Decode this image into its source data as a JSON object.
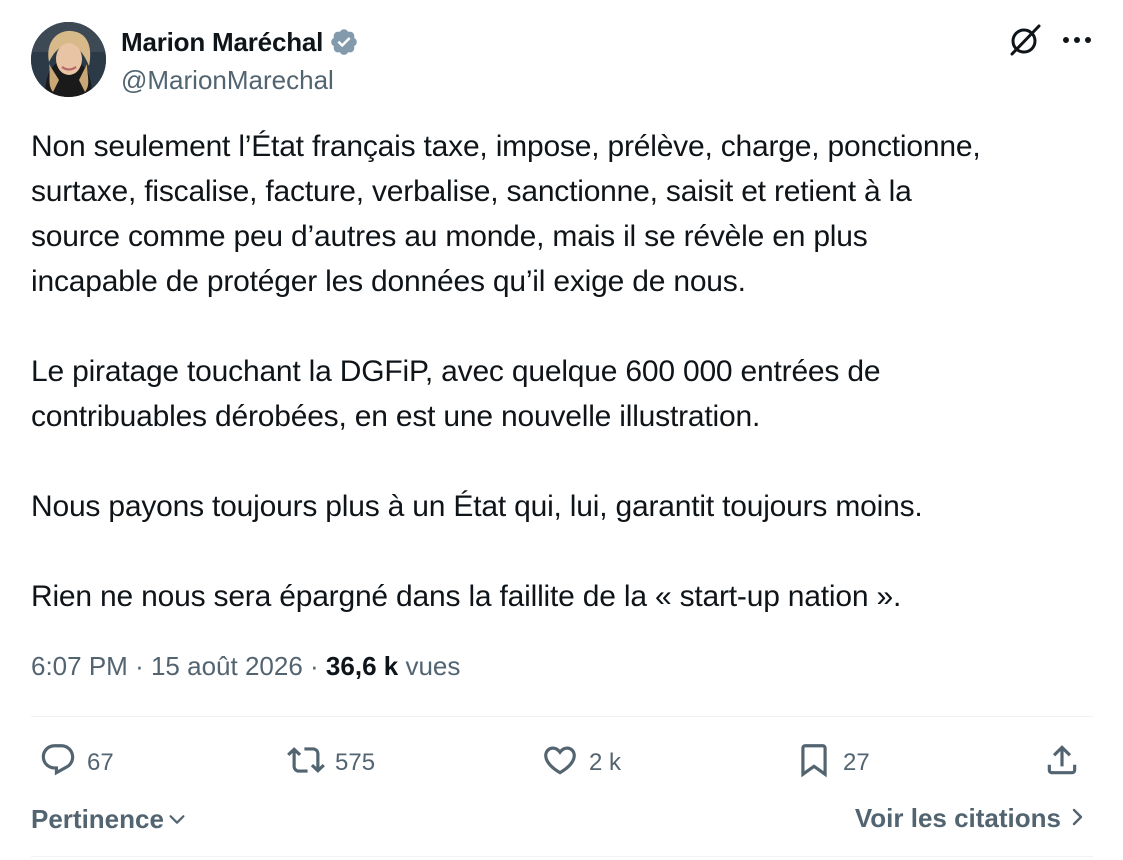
{
  "author": {
    "name": "Marion Maréchal",
    "handle": "@MarionMarechal",
    "verified": true
  },
  "tweet": {
    "paragraphs": [
      [
        "Non seulement l’État français taxe, impose, prélève, charge, ponctionne,",
        "surtaxe, fiscalise, facture, verbalise, sanctionne, saisit et retient à la",
        "source comme peu d’autres au monde, mais il se révèle en plus",
        "incapable de protéger les données qu’il exige de nous."
      ],
      [
        "Le piratage touchant la DGFiP, avec quelque 600 000 entrées de",
        "contribuables dérobées, en est une nouvelle illustration."
      ],
      [
        "Nous payons toujours plus à un État qui, lui, garantit toujours moins."
      ],
      [
        "Rien ne nous sera épargné dans la faillite de la « start-up nation »."
      ]
    ],
    "time": "6:07 PM",
    "separator": "·",
    "date": "15 août 2026",
    "views_count": "36,6 k",
    "views_label": "vues"
  },
  "actions": {
    "replies": "67",
    "reposts": "575",
    "likes": "2 k",
    "bookmarks": "27"
  },
  "footer": {
    "sort_label": "Pertinence",
    "quotes_label": "Voir les citations"
  },
  "icons": {
    "verified": "verified-badge-icon",
    "grok": "grok-icon",
    "more": "more-icon",
    "reply": "reply-icon",
    "repost": "repost-icon",
    "like": "heart-icon",
    "bookmark": "bookmark-icon",
    "share": "share-icon"
  },
  "colors": {
    "text": "#0f1419",
    "secondary": "#536471",
    "divider": "#eff3f4",
    "verified_badge": "#829aab"
  }
}
